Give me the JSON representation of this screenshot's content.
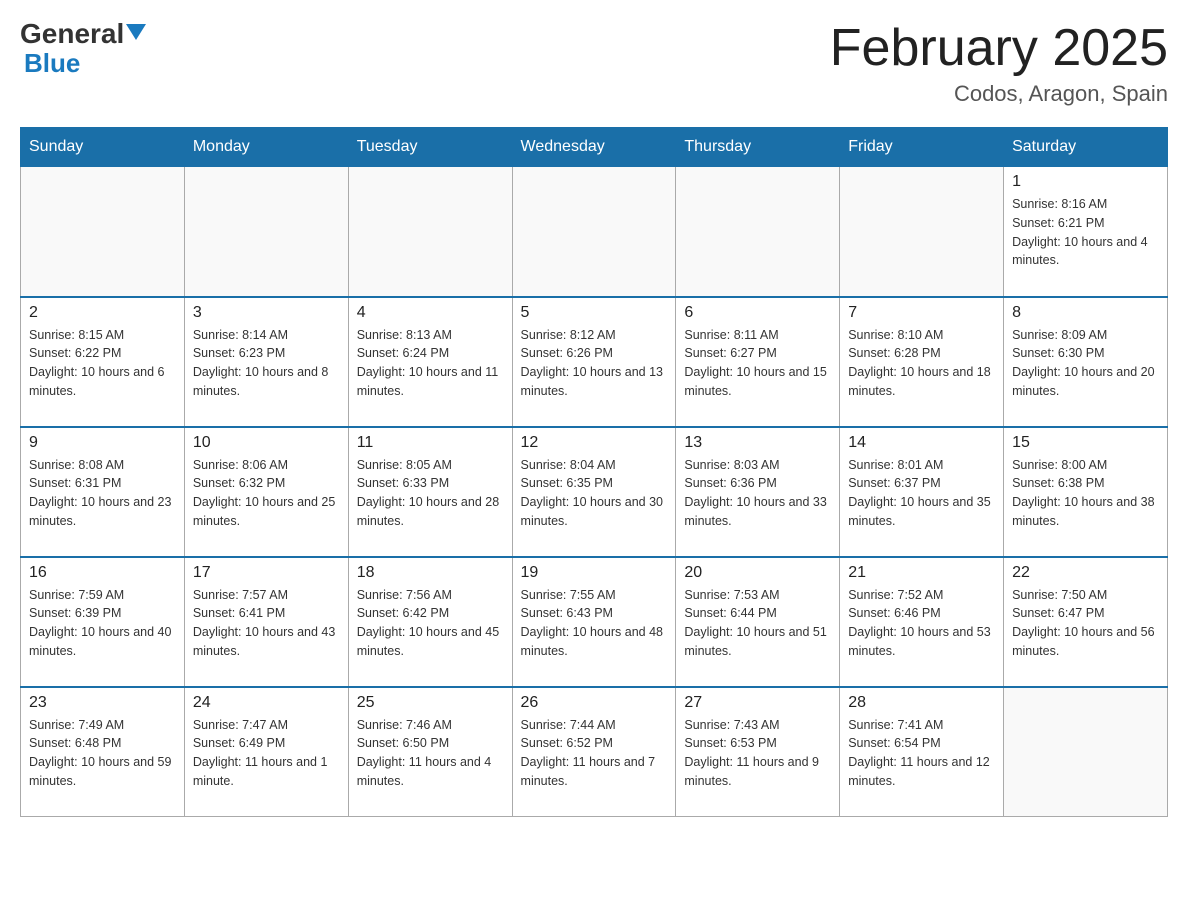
{
  "header": {
    "logo_general": "General",
    "logo_blue": "Blue",
    "month_title": "February 2025",
    "location": "Codos, Aragon, Spain"
  },
  "days_of_week": [
    "Sunday",
    "Monday",
    "Tuesday",
    "Wednesday",
    "Thursday",
    "Friday",
    "Saturday"
  ],
  "weeks": [
    [
      {
        "day": "",
        "info": ""
      },
      {
        "day": "",
        "info": ""
      },
      {
        "day": "",
        "info": ""
      },
      {
        "day": "",
        "info": ""
      },
      {
        "day": "",
        "info": ""
      },
      {
        "day": "",
        "info": ""
      },
      {
        "day": "1",
        "info": "Sunrise: 8:16 AM\nSunset: 6:21 PM\nDaylight: 10 hours and 4 minutes."
      }
    ],
    [
      {
        "day": "2",
        "info": "Sunrise: 8:15 AM\nSunset: 6:22 PM\nDaylight: 10 hours and 6 minutes."
      },
      {
        "day": "3",
        "info": "Sunrise: 8:14 AM\nSunset: 6:23 PM\nDaylight: 10 hours and 8 minutes."
      },
      {
        "day": "4",
        "info": "Sunrise: 8:13 AM\nSunset: 6:24 PM\nDaylight: 10 hours and 11 minutes."
      },
      {
        "day": "5",
        "info": "Sunrise: 8:12 AM\nSunset: 6:26 PM\nDaylight: 10 hours and 13 minutes."
      },
      {
        "day": "6",
        "info": "Sunrise: 8:11 AM\nSunset: 6:27 PM\nDaylight: 10 hours and 15 minutes."
      },
      {
        "day": "7",
        "info": "Sunrise: 8:10 AM\nSunset: 6:28 PM\nDaylight: 10 hours and 18 minutes."
      },
      {
        "day": "8",
        "info": "Sunrise: 8:09 AM\nSunset: 6:30 PM\nDaylight: 10 hours and 20 minutes."
      }
    ],
    [
      {
        "day": "9",
        "info": "Sunrise: 8:08 AM\nSunset: 6:31 PM\nDaylight: 10 hours and 23 minutes."
      },
      {
        "day": "10",
        "info": "Sunrise: 8:06 AM\nSunset: 6:32 PM\nDaylight: 10 hours and 25 minutes."
      },
      {
        "day": "11",
        "info": "Sunrise: 8:05 AM\nSunset: 6:33 PM\nDaylight: 10 hours and 28 minutes."
      },
      {
        "day": "12",
        "info": "Sunrise: 8:04 AM\nSunset: 6:35 PM\nDaylight: 10 hours and 30 minutes."
      },
      {
        "day": "13",
        "info": "Sunrise: 8:03 AM\nSunset: 6:36 PM\nDaylight: 10 hours and 33 minutes."
      },
      {
        "day": "14",
        "info": "Sunrise: 8:01 AM\nSunset: 6:37 PM\nDaylight: 10 hours and 35 minutes."
      },
      {
        "day": "15",
        "info": "Sunrise: 8:00 AM\nSunset: 6:38 PM\nDaylight: 10 hours and 38 minutes."
      }
    ],
    [
      {
        "day": "16",
        "info": "Sunrise: 7:59 AM\nSunset: 6:39 PM\nDaylight: 10 hours and 40 minutes."
      },
      {
        "day": "17",
        "info": "Sunrise: 7:57 AM\nSunset: 6:41 PM\nDaylight: 10 hours and 43 minutes."
      },
      {
        "day": "18",
        "info": "Sunrise: 7:56 AM\nSunset: 6:42 PM\nDaylight: 10 hours and 45 minutes."
      },
      {
        "day": "19",
        "info": "Sunrise: 7:55 AM\nSunset: 6:43 PM\nDaylight: 10 hours and 48 minutes."
      },
      {
        "day": "20",
        "info": "Sunrise: 7:53 AM\nSunset: 6:44 PM\nDaylight: 10 hours and 51 minutes."
      },
      {
        "day": "21",
        "info": "Sunrise: 7:52 AM\nSunset: 6:46 PM\nDaylight: 10 hours and 53 minutes."
      },
      {
        "day": "22",
        "info": "Sunrise: 7:50 AM\nSunset: 6:47 PM\nDaylight: 10 hours and 56 minutes."
      }
    ],
    [
      {
        "day": "23",
        "info": "Sunrise: 7:49 AM\nSunset: 6:48 PM\nDaylight: 10 hours and 59 minutes."
      },
      {
        "day": "24",
        "info": "Sunrise: 7:47 AM\nSunset: 6:49 PM\nDaylight: 11 hours and 1 minute."
      },
      {
        "day": "25",
        "info": "Sunrise: 7:46 AM\nSunset: 6:50 PM\nDaylight: 11 hours and 4 minutes."
      },
      {
        "day": "26",
        "info": "Sunrise: 7:44 AM\nSunset: 6:52 PM\nDaylight: 11 hours and 7 minutes."
      },
      {
        "day": "27",
        "info": "Sunrise: 7:43 AM\nSunset: 6:53 PM\nDaylight: 11 hours and 9 minutes."
      },
      {
        "day": "28",
        "info": "Sunrise: 7:41 AM\nSunset: 6:54 PM\nDaylight: 11 hours and 12 minutes."
      },
      {
        "day": "",
        "info": ""
      }
    ]
  ]
}
